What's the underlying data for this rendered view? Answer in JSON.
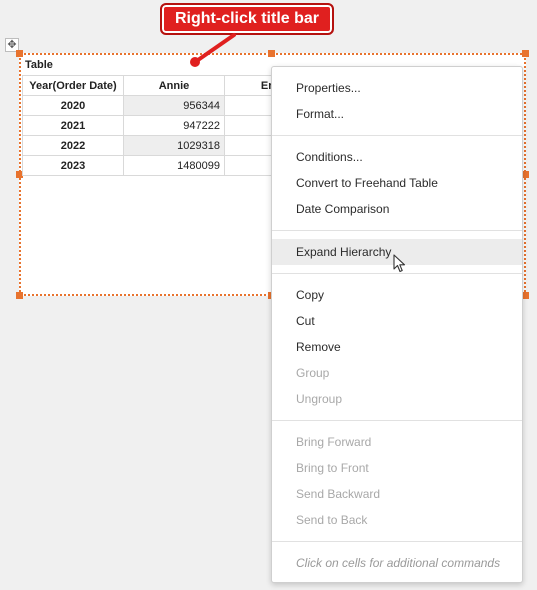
{
  "annotation": {
    "callout_text": "Right-click title bar",
    "color": "#e0201f"
  },
  "move_handle_icon": "move-arrows-icon",
  "table": {
    "title": "Table",
    "columns": [
      "Year(Order Date)",
      "Annie",
      "Er"
    ],
    "rows": [
      {
        "year": "2020",
        "annie": "956344"
      },
      {
        "year": "2021",
        "annie": "947222"
      },
      {
        "year": "2022",
        "annie": "1029318"
      },
      {
        "year": "2023",
        "annie": "1480099"
      }
    ],
    "selection_color": "#e8732e"
  },
  "context_menu": {
    "items": [
      {
        "label": "Properties...",
        "enabled": true
      },
      {
        "label": "Format...",
        "enabled": true
      },
      {
        "label": "Conditions...",
        "enabled": true
      },
      {
        "label": "Convert to Freehand Table",
        "enabled": true
      },
      {
        "label": "Date Comparison",
        "enabled": true
      },
      {
        "label": "Expand Hierarchy",
        "enabled": true,
        "highlighted": true
      },
      {
        "label": "Copy",
        "enabled": true
      },
      {
        "label": "Cut",
        "enabled": true
      },
      {
        "label": "Remove",
        "enabled": true
      },
      {
        "label": "Group",
        "enabled": false
      },
      {
        "label": "Ungroup",
        "enabled": false
      },
      {
        "label": "Bring Forward",
        "enabled": false
      },
      {
        "label": "Bring to Front",
        "enabled": false
      },
      {
        "label": "Send Backward",
        "enabled": false
      },
      {
        "label": "Send to Back",
        "enabled": false
      }
    ],
    "hint": "Click on cells for additional commands"
  }
}
